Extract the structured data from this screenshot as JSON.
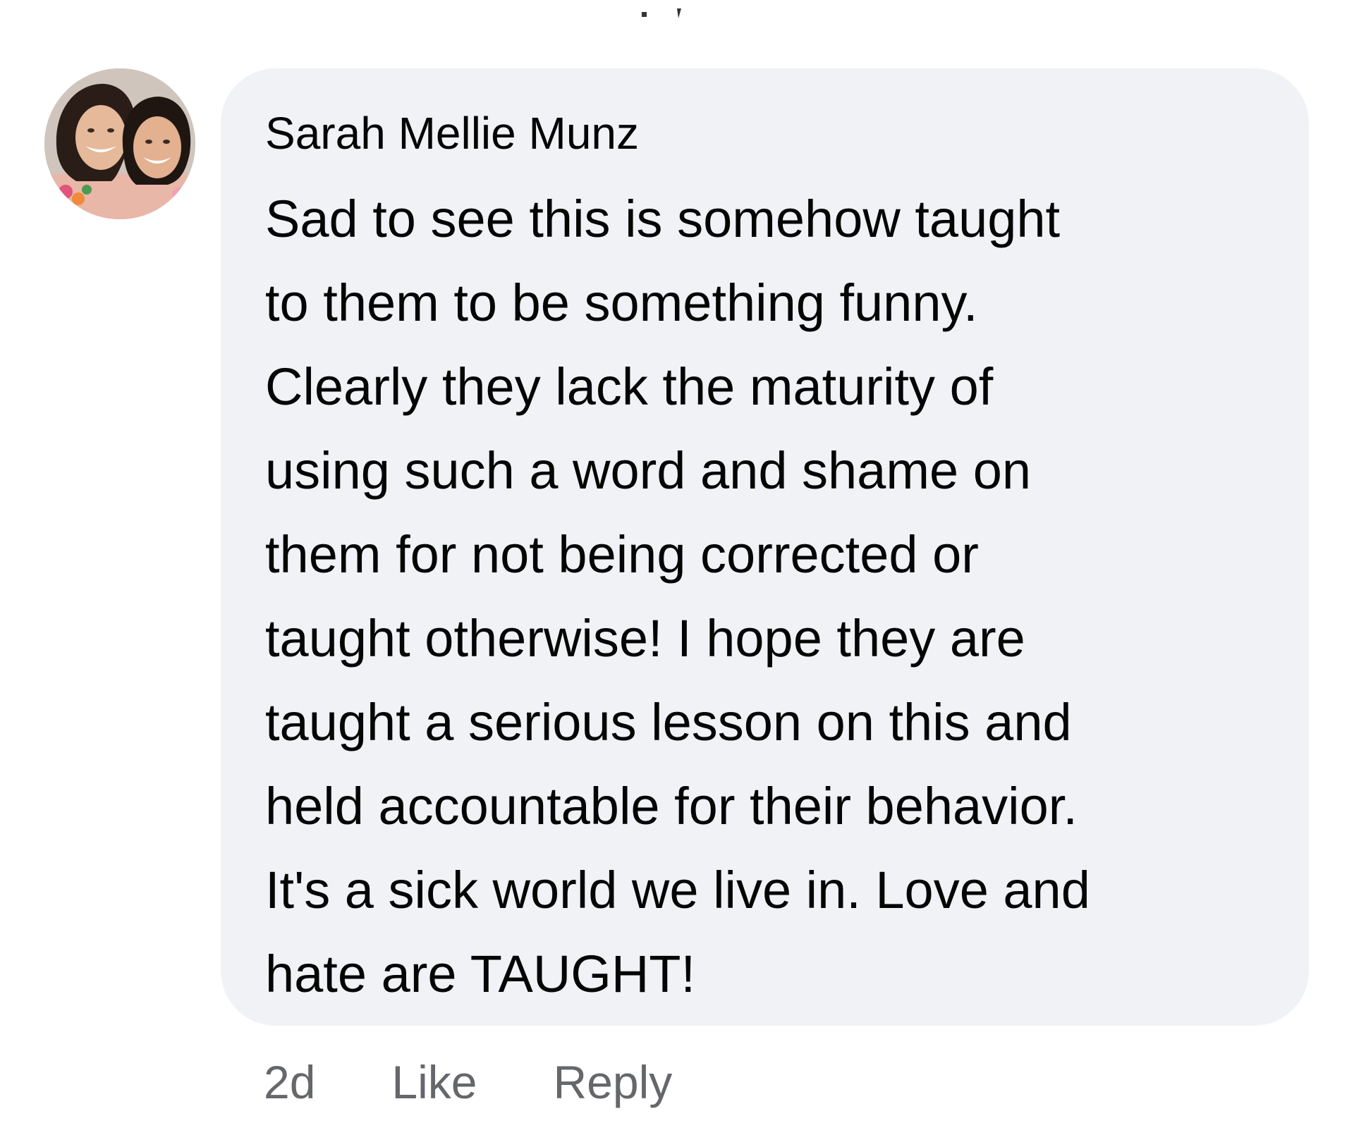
{
  "comment": {
    "author": "Sarah Mellie Munz",
    "text_lines": [
      "Sad to see this is somehow taught",
      "to them to be something funny.",
      "Clearly they lack the maturity of",
      "using such a word and shame on",
      "them for not being corrected or",
      "taught otherwise! I hope they are",
      "taught a serious lesson on this and",
      "held accountable for their behavior.",
      "It's a sick world we live in. Love and",
      "hate are TAUGHT!"
    ],
    "avatar_icon": "profile-photo",
    "bubble_color": "#f0f2f5"
  },
  "actions": {
    "timestamp": "2d",
    "like_label": "Like",
    "reply_label": "Reply",
    "color": "#65676b"
  }
}
